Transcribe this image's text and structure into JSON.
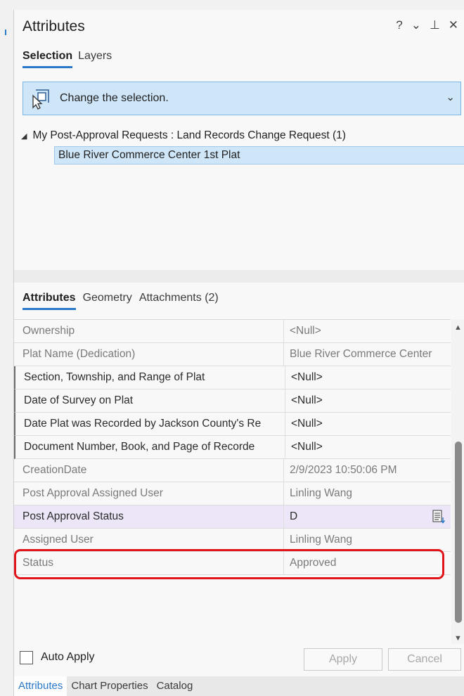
{
  "header": {
    "title": "Attributes",
    "help": "?",
    "menu": "⌄",
    "pin": "⊥",
    "close": "✕"
  },
  "top_tabs": [
    {
      "label": "Selection",
      "active": true
    },
    {
      "label": "Layers",
      "active": false
    }
  ],
  "selection_combo": {
    "label": "Change the selection.",
    "chevron": "⌄",
    "icon": "select-features-icon"
  },
  "tree": {
    "group": "My Post-Approval Requests : Land Records Change Request (1)",
    "expand_glyph": "◢",
    "selected_item": "Blue River Commerce Center 1st Plat"
  },
  "mid_tabs": [
    {
      "label": "Attributes",
      "active": true
    },
    {
      "label": "Geometry",
      "active": false
    },
    {
      "label": "Attachments (2)",
      "active": false
    }
  ],
  "rows": [
    {
      "field": "Ownership",
      "value": "<Null>"
    },
    {
      "field": "Plat Name (Dedication)",
      "value": "Blue River Commerce Center"
    },
    {
      "field": "Section, Township, and Range of Plat",
      "value": "<Null>"
    },
    {
      "field": "Date of Survey on Plat",
      "value": "<Null>"
    },
    {
      "field": "Date Plat was Recorded by Jackson County's Re",
      "value": "<Null>"
    },
    {
      "field": "Document Number, Book, and Page of Recorde",
      "value": "<Null>"
    },
    {
      "field": "CreationDate",
      "value": "2/9/2023 10:50:06 PM"
    },
    {
      "field": "Post Approval Assigned User",
      "value": "Linling Wang"
    },
    {
      "field": "Post Approval Status",
      "value": "D"
    },
    {
      "field": "Assigned User",
      "value": "Linling Wang"
    },
    {
      "field": "Status",
      "value": "Approved"
    }
  ],
  "scrollbar": {
    "up": "▲",
    "down": "▼"
  },
  "footer": {
    "auto_apply": "Auto Apply",
    "apply": "Apply",
    "cancel": "Cancel"
  },
  "bottom_tabs": [
    {
      "label": "Attributes",
      "active": true
    },
    {
      "label": "Chart Properties",
      "active": false
    },
    {
      "label": "Catalog",
      "active": false
    }
  ],
  "colors": {
    "accent": "#2a78c8",
    "selection_fill": "#cfe6f8",
    "highlight_row": "#ece6f8",
    "callout_border": "#e0141b"
  }
}
